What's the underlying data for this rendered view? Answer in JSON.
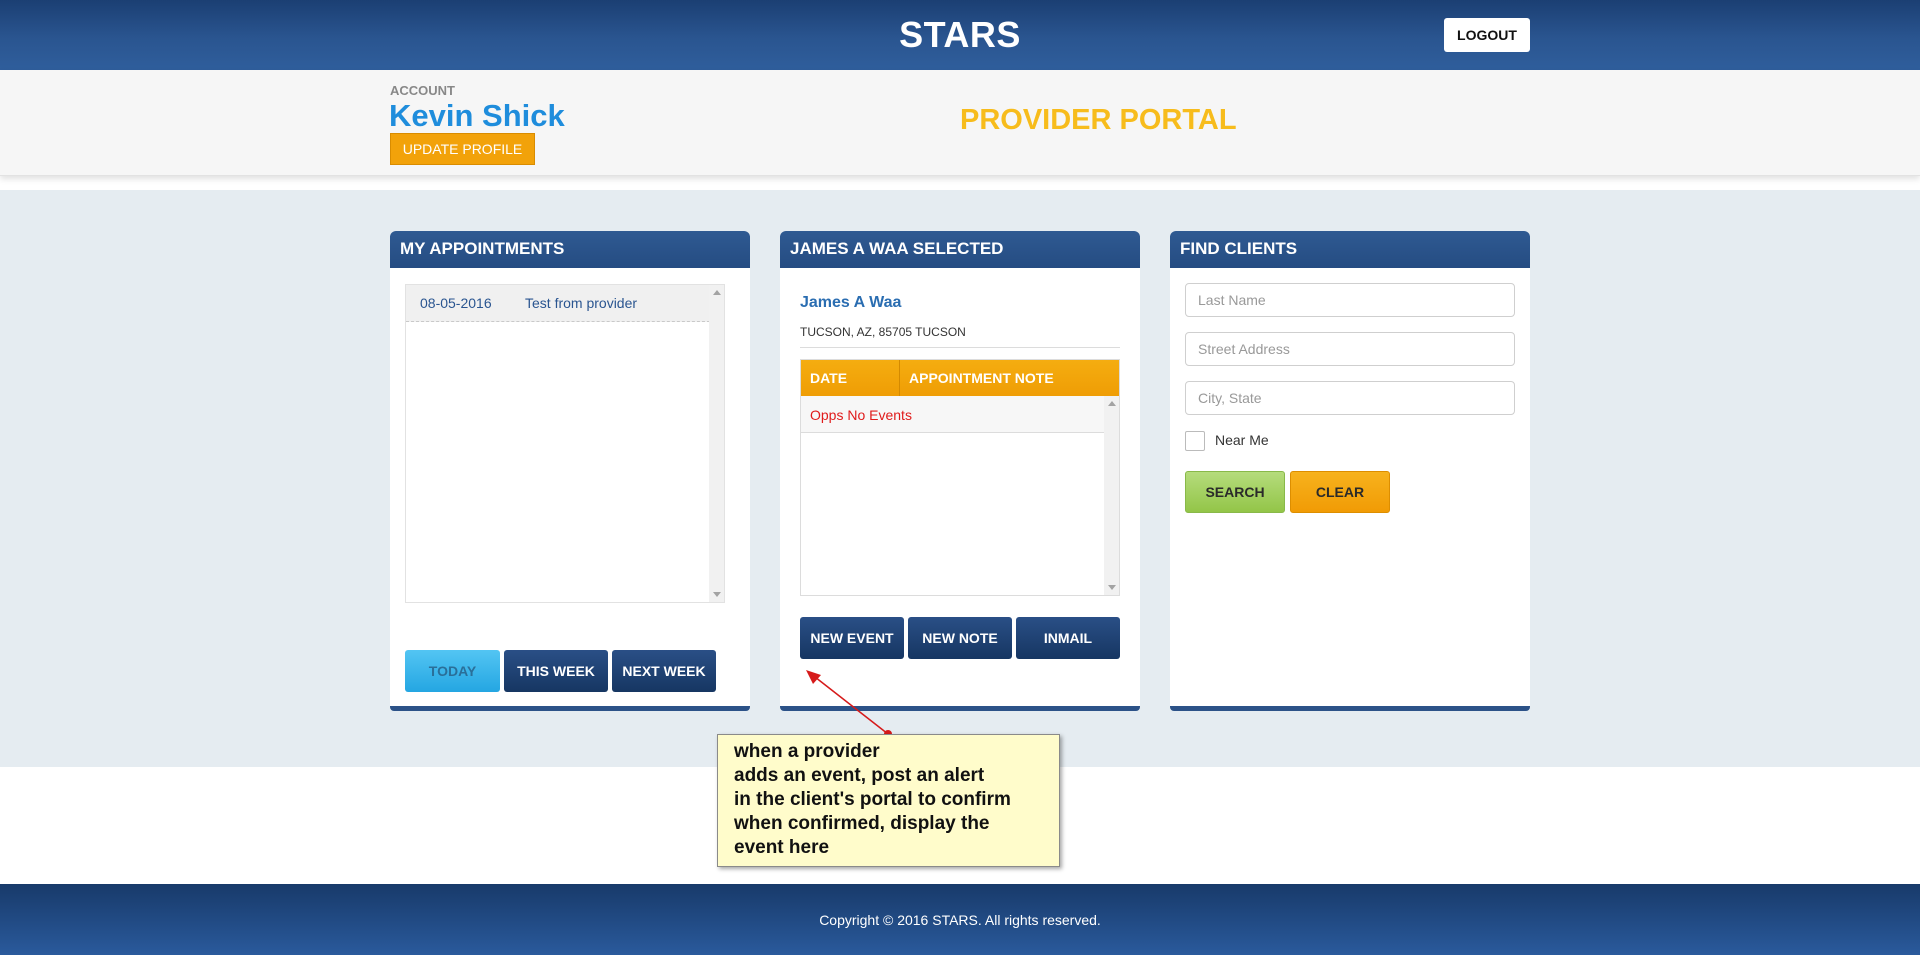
{
  "topbar": {
    "brand": "STARS",
    "logout_label": "LOGOUT"
  },
  "account": {
    "label": "ACCOUNT",
    "name": "Kevin Shick",
    "update_label": "UPDATE PROFILE",
    "portal_title": "PROVIDER PORTAL"
  },
  "appointments": {
    "title": "MY APPOINTMENTS",
    "items": [
      {
        "date": "08-05-2016",
        "text": "Test from provider"
      }
    ],
    "buttons": {
      "today": "TODAY",
      "this_week": "THIS WEEK",
      "next_week": "NEXT WEEK"
    }
  },
  "selected": {
    "title": "JAMES A WAA SELECTED",
    "client_name": "James A Waa",
    "client_address": "TUCSON, AZ, 85705 TUCSON",
    "table": {
      "col_date": "DATE",
      "col_note": "APPOINTMENT NOTE",
      "empty_message": "Opps No Events"
    },
    "buttons": {
      "new_event": "NEW EVENT",
      "new_note": "NEW NOTE",
      "inmail": "INMAIL"
    }
  },
  "find_clients": {
    "title": "FIND CLIENTS",
    "last_name_placeholder": "Last Name",
    "street_placeholder": "Street Address",
    "city_placeholder": "City, State",
    "near_me_label": "Near Me",
    "search_label": "SEARCH",
    "clear_label": "CLEAR"
  },
  "annotation": {
    "lines": [
      "when a provider",
      "adds an event, post an alert",
      "in the client's portal to confirm",
      "when confirmed, display the",
      "event here"
    ]
  },
  "footer": {
    "copyright": "Copyright © 2016 STARS. All rights reserved."
  }
}
